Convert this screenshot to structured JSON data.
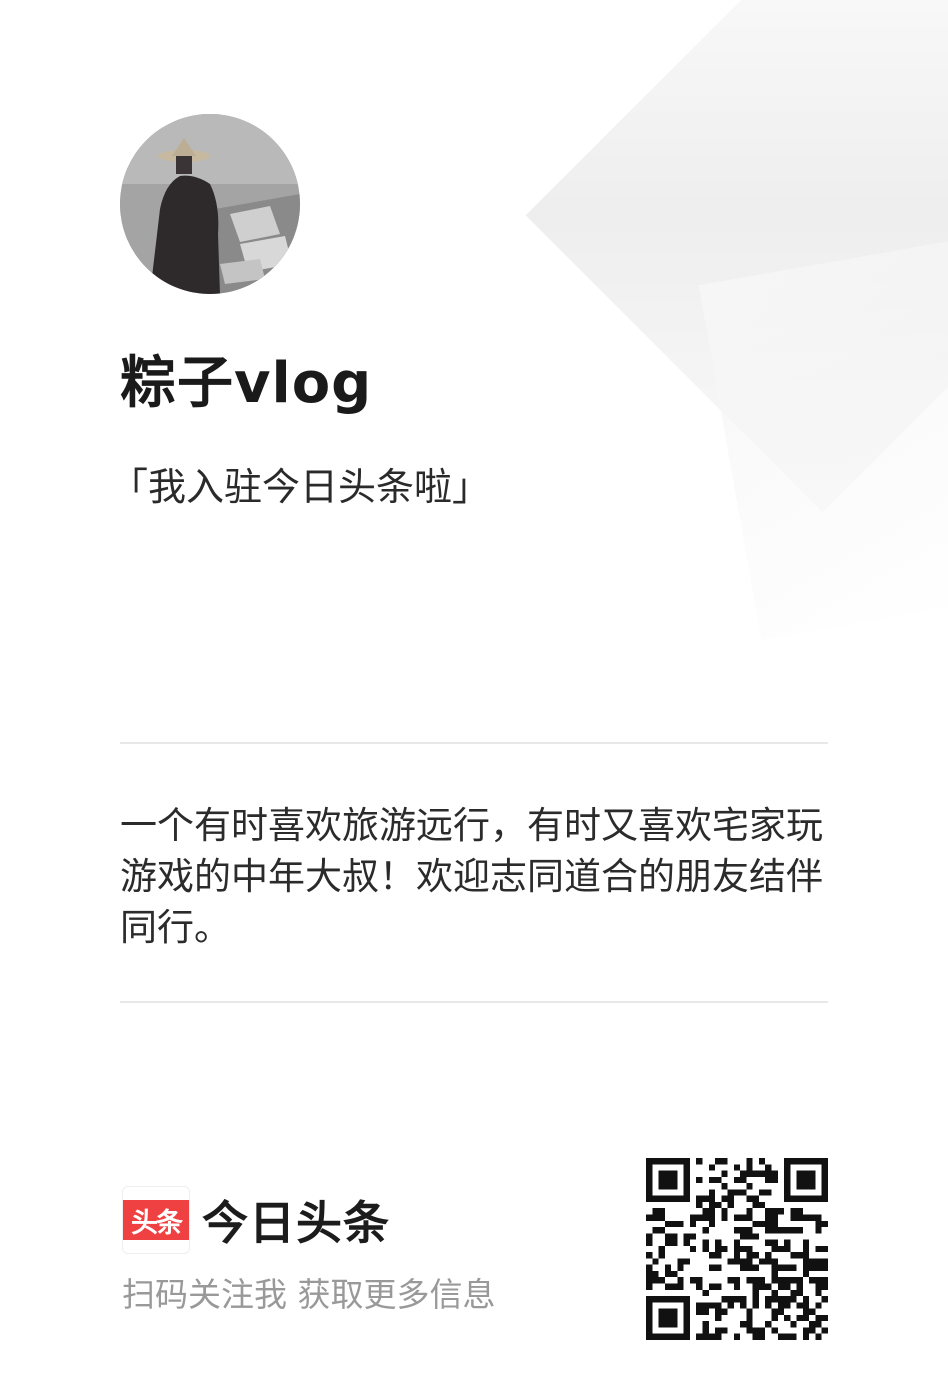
{
  "profile": {
    "username": "粽子vlog",
    "tagline": "「我入驻今日头条啦」",
    "bio": "一个有时喜欢旅游远行，有时又喜欢宅家玩游戏的中年大叔！欢迎志同道合的朋友结伴同行。",
    "avatar_icon": "avatar-photo"
  },
  "footer": {
    "brand_logo_text": "头条",
    "brand_name": "今日头条",
    "cta": "扫码关注我 获取更多信息",
    "qr_icon": "qr-code-icon"
  },
  "colors": {
    "brand_red": "#f04142",
    "muted_text": "#999999",
    "divider": "#e8e8e8"
  }
}
